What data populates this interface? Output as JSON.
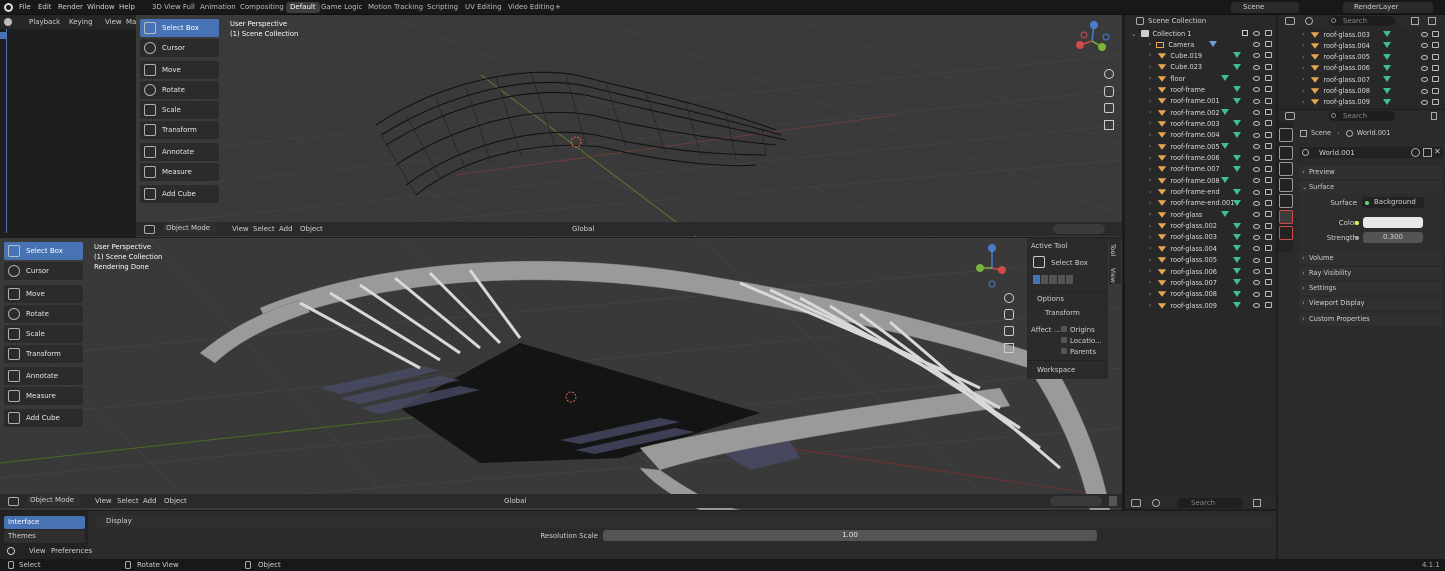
{
  "topbar": {
    "menus": [
      "File",
      "Edit",
      "Render",
      "Window",
      "Help"
    ],
    "workspaces": [
      "3D View Full",
      "Animation",
      "Compositing",
      "Default",
      "Game Logic",
      "Motion Tracking",
      "Scripting",
      "UV Editing",
      "Video Editing"
    ],
    "active_workspace": "Default",
    "add_tab": "+",
    "scene": "Scene",
    "view_layer": "RenderLayer"
  },
  "timeline": {
    "menus": [
      "Playback",
      "Keying",
      "View",
      "Ma"
    ]
  },
  "viewport_top": {
    "perspective": "User Perspective",
    "collection": "(1) Scene Collection",
    "tools": [
      "Select Box",
      "Cursor",
      "Move",
      "Rotate",
      "Scale",
      "Transform",
      "Annotate",
      "Measure",
      "Add Cube"
    ],
    "header": {
      "mode": "Object Mode",
      "menus": [
        "View",
        "Select",
        "Add",
        "Object"
      ],
      "orientation": "Global"
    }
  },
  "viewport_bottom": {
    "perspective": "User Perspective",
    "collection": "(1) Scene Collection",
    "status": "Rendering Done",
    "tools": [
      "Select Box",
      "Cursor",
      "Move",
      "Rotate",
      "Scale",
      "Transform",
      "Annotate",
      "Measure",
      "Add Cube"
    ],
    "header": {
      "mode": "Object Mode",
      "menus": [
        "View",
        "Select",
        "Add",
        "Object"
      ],
      "orientation": "Global"
    },
    "npanel": {
      "tabs": [
        "Tool",
        "View"
      ],
      "active_tool_title": "Active Tool",
      "active_tool": "Select Box",
      "options_title": "Options",
      "transform_title": "Transform",
      "affect_label": "Affect ...",
      "affect_items": [
        "Origins",
        "Locatio...",
        "Parents"
      ],
      "workspace_title": "Workspace"
    }
  },
  "preferences": {
    "tabs": [
      "Interface",
      "Themes"
    ],
    "section": "Display",
    "resolution_label": "Resolution Scale",
    "resolution_value": "1.00",
    "menus": [
      "View",
      "Preferences"
    ]
  },
  "outliner": {
    "search_placeholder": "Search",
    "root": "Scene Collection",
    "collection": "Collection 1",
    "items": [
      "Camera",
      "Cube.019",
      "Cube.023",
      "floor",
      "roof-frame",
      "roof-frame.001",
      "roof-frame.002",
      "roof-frame.003",
      "roof-frame.004",
      "roof-frame.005",
      "roof-frame.006",
      "roof-frame.007",
      "roof-frame.008",
      "roof-frame-end",
      "roof-frame-end.001",
      "roof-glass",
      "roof-glass.002",
      "roof-glass.003",
      "roof-glass.004",
      "roof-glass.005",
      "roof-glass.006",
      "roof-glass.007",
      "roof-glass.008",
      "roof-glass.009"
    ]
  },
  "outliner2": {
    "items": [
      "roof-glass.003",
      "roof-glass.004",
      "roof-glass.005",
      "roof-glass.006",
      "roof-glass.007",
      "roof-glass.008",
      "roof-glass.009"
    ]
  },
  "properties": {
    "search_placeholder": "Search",
    "breadcrumb_scene": "Scene",
    "breadcrumb_world": "World.001",
    "world_name": "World.001",
    "panels": [
      "Preview",
      "Surface",
      "Volume",
      "Ray Visibility",
      "Settings",
      "Viewport Display",
      "Custom Properties"
    ],
    "surface_label": "Surface",
    "surface_value": "Background",
    "color_label": "Color",
    "strength_label": "Strength",
    "strength_value": "0.300"
  },
  "search_small": "Search",
  "statusbar": {
    "items": [
      "Select",
      "Rotate View",
      "Object"
    ],
    "version": "4.1.1"
  },
  "colors": {
    "accent": "#4772b3",
    "orange": "#e9a54e",
    "green": "#6dd36d"
  }
}
